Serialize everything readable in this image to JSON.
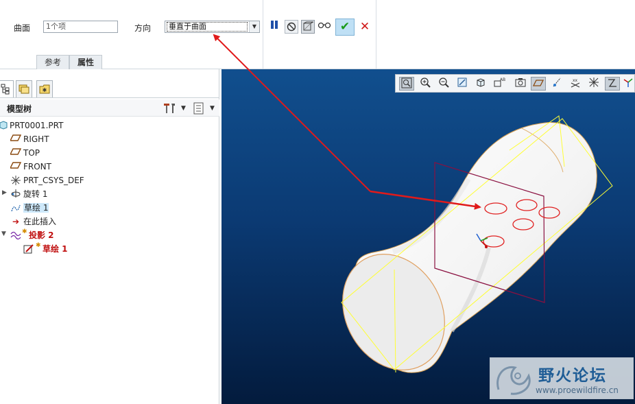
{
  "dashboard": {
    "surface_label": "曲面",
    "surface_value": "1个项",
    "direction_label": "方向",
    "direction_value": "垂直于曲面",
    "tabs": [
      "参考",
      "属性"
    ],
    "buttons": {
      "pause": "pause-icon",
      "no_preview": "no-preview-icon",
      "preview_box": "preview-icon",
      "glasses": "glasses-icon",
      "ok": "✔",
      "cancel": "✕"
    }
  },
  "model_tree": {
    "title": "模型树",
    "items": [
      {
        "label": "PRT0001.PRT",
        "icon": "part-icon"
      },
      {
        "label": "RIGHT",
        "icon": "datum-plane-icon"
      },
      {
        "label": "TOP",
        "icon": "datum-plane-icon"
      },
      {
        "label": "FRONT",
        "icon": "datum-plane-icon"
      },
      {
        "label": "PRT_CSYS_DEF",
        "icon": "csys-icon"
      },
      {
        "label": "旋转 1",
        "icon": "revolve-icon"
      },
      {
        "label": "草绘 1",
        "icon": "sketch-icon"
      },
      {
        "label": "在此插入",
        "icon": "insert-here-icon"
      },
      {
        "label": "投影 2",
        "icon": "projection-icon"
      },
      {
        "label": "草绘 1",
        "icon": "sketch-edit-icon"
      }
    ]
  },
  "watermark": {
    "title": "野火论坛",
    "url": "www.proewildfire.cn"
  },
  "colors": {
    "viewport_top": "#114f8e",
    "viewport_bottom": "#031b3d",
    "annotation_arrow": "#e01a1a",
    "datum_yellow": "#ffff33",
    "sketch_red": "#e02020",
    "accent_ok": "#1a9a1a"
  }
}
